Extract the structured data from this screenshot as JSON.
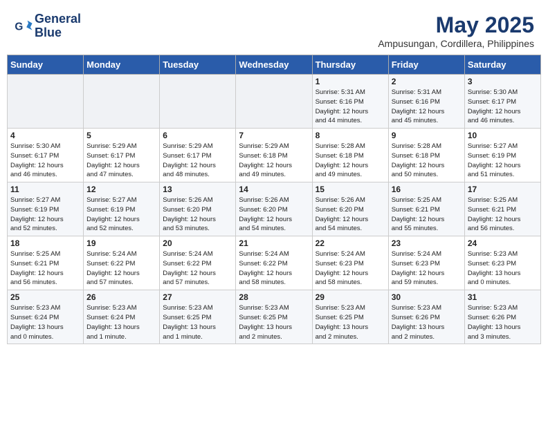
{
  "header": {
    "logo_line1": "General",
    "logo_line2": "Blue",
    "month": "May 2025",
    "location": "Ampusungan, Cordillera, Philippines"
  },
  "weekdays": [
    "Sunday",
    "Monday",
    "Tuesday",
    "Wednesday",
    "Thursday",
    "Friday",
    "Saturday"
  ],
  "weeks": [
    [
      {
        "day": "",
        "info": ""
      },
      {
        "day": "",
        "info": ""
      },
      {
        "day": "",
        "info": ""
      },
      {
        "day": "",
        "info": ""
      },
      {
        "day": "1",
        "info": "Sunrise: 5:31 AM\nSunset: 6:16 PM\nDaylight: 12 hours\nand 44 minutes."
      },
      {
        "day": "2",
        "info": "Sunrise: 5:31 AM\nSunset: 6:16 PM\nDaylight: 12 hours\nand 45 minutes."
      },
      {
        "day": "3",
        "info": "Sunrise: 5:30 AM\nSunset: 6:17 PM\nDaylight: 12 hours\nand 46 minutes."
      }
    ],
    [
      {
        "day": "4",
        "info": "Sunrise: 5:30 AM\nSunset: 6:17 PM\nDaylight: 12 hours\nand 46 minutes."
      },
      {
        "day": "5",
        "info": "Sunrise: 5:29 AM\nSunset: 6:17 PM\nDaylight: 12 hours\nand 47 minutes."
      },
      {
        "day": "6",
        "info": "Sunrise: 5:29 AM\nSunset: 6:17 PM\nDaylight: 12 hours\nand 48 minutes."
      },
      {
        "day": "7",
        "info": "Sunrise: 5:29 AM\nSunset: 6:18 PM\nDaylight: 12 hours\nand 49 minutes."
      },
      {
        "day": "8",
        "info": "Sunrise: 5:28 AM\nSunset: 6:18 PM\nDaylight: 12 hours\nand 49 minutes."
      },
      {
        "day": "9",
        "info": "Sunrise: 5:28 AM\nSunset: 6:18 PM\nDaylight: 12 hours\nand 50 minutes."
      },
      {
        "day": "10",
        "info": "Sunrise: 5:27 AM\nSunset: 6:19 PM\nDaylight: 12 hours\nand 51 minutes."
      }
    ],
    [
      {
        "day": "11",
        "info": "Sunrise: 5:27 AM\nSunset: 6:19 PM\nDaylight: 12 hours\nand 52 minutes."
      },
      {
        "day": "12",
        "info": "Sunrise: 5:27 AM\nSunset: 6:19 PM\nDaylight: 12 hours\nand 52 minutes."
      },
      {
        "day": "13",
        "info": "Sunrise: 5:26 AM\nSunset: 6:20 PM\nDaylight: 12 hours\nand 53 minutes."
      },
      {
        "day": "14",
        "info": "Sunrise: 5:26 AM\nSunset: 6:20 PM\nDaylight: 12 hours\nand 54 minutes."
      },
      {
        "day": "15",
        "info": "Sunrise: 5:26 AM\nSunset: 6:20 PM\nDaylight: 12 hours\nand 54 minutes."
      },
      {
        "day": "16",
        "info": "Sunrise: 5:25 AM\nSunset: 6:21 PM\nDaylight: 12 hours\nand 55 minutes."
      },
      {
        "day": "17",
        "info": "Sunrise: 5:25 AM\nSunset: 6:21 PM\nDaylight: 12 hours\nand 56 minutes."
      }
    ],
    [
      {
        "day": "18",
        "info": "Sunrise: 5:25 AM\nSunset: 6:21 PM\nDaylight: 12 hours\nand 56 minutes."
      },
      {
        "day": "19",
        "info": "Sunrise: 5:24 AM\nSunset: 6:22 PM\nDaylight: 12 hours\nand 57 minutes."
      },
      {
        "day": "20",
        "info": "Sunrise: 5:24 AM\nSunset: 6:22 PM\nDaylight: 12 hours\nand 57 minutes."
      },
      {
        "day": "21",
        "info": "Sunrise: 5:24 AM\nSunset: 6:22 PM\nDaylight: 12 hours\nand 58 minutes."
      },
      {
        "day": "22",
        "info": "Sunrise: 5:24 AM\nSunset: 6:23 PM\nDaylight: 12 hours\nand 58 minutes."
      },
      {
        "day": "23",
        "info": "Sunrise: 5:24 AM\nSunset: 6:23 PM\nDaylight: 12 hours\nand 59 minutes."
      },
      {
        "day": "24",
        "info": "Sunrise: 5:23 AM\nSunset: 6:23 PM\nDaylight: 13 hours\nand 0 minutes."
      }
    ],
    [
      {
        "day": "25",
        "info": "Sunrise: 5:23 AM\nSunset: 6:24 PM\nDaylight: 13 hours\nand 0 minutes."
      },
      {
        "day": "26",
        "info": "Sunrise: 5:23 AM\nSunset: 6:24 PM\nDaylight: 13 hours\nand 1 minute."
      },
      {
        "day": "27",
        "info": "Sunrise: 5:23 AM\nSunset: 6:25 PM\nDaylight: 13 hours\nand 1 minute."
      },
      {
        "day": "28",
        "info": "Sunrise: 5:23 AM\nSunset: 6:25 PM\nDaylight: 13 hours\nand 2 minutes."
      },
      {
        "day": "29",
        "info": "Sunrise: 5:23 AM\nSunset: 6:25 PM\nDaylight: 13 hours\nand 2 minutes."
      },
      {
        "day": "30",
        "info": "Sunrise: 5:23 AM\nSunset: 6:26 PM\nDaylight: 13 hours\nand 2 minutes."
      },
      {
        "day": "31",
        "info": "Sunrise: 5:23 AM\nSunset: 6:26 PM\nDaylight: 13 hours\nand 3 minutes."
      }
    ]
  ]
}
